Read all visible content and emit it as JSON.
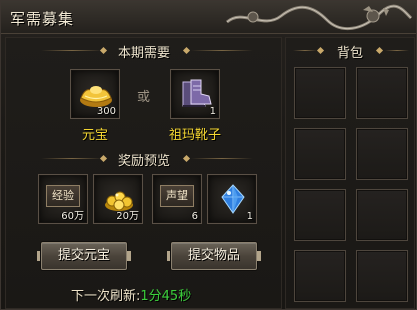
{
  "window": {
    "title": "军需募集"
  },
  "required": {
    "section_title": "本期需要",
    "or_label": "或",
    "items": [
      {
        "name": "元宝",
        "count": "300",
        "icon": "gold-ingot-icon"
      },
      {
        "name": "祖玛靴子",
        "count": "1",
        "icon": "zuma-boots-icon"
      }
    ]
  },
  "rewards": {
    "section_title": "奖励预览",
    "items": [
      {
        "label": "经验",
        "count": "60万",
        "icon": "experience-stamp-icon"
      },
      {
        "label": "",
        "count": "20万",
        "icon": "gold-coins-icon"
      },
      {
        "label": "声望",
        "count": "6",
        "icon": "reputation-stamp-icon"
      },
      {
        "label": "",
        "count": "1",
        "icon": "blue-crystal-icon"
      }
    ]
  },
  "buttons": {
    "submit_ingot": "提交元宝",
    "submit_item": "提交物品"
  },
  "refresh": {
    "label": "下一次刷新:",
    "time": "1分45秒"
  },
  "bag": {
    "title": "背包",
    "slot_count": 8
  },
  "colors": {
    "item_name": "#f4d631",
    "timer": "#3ccf3c",
    "accent": "#c9a96b"
  }
}
